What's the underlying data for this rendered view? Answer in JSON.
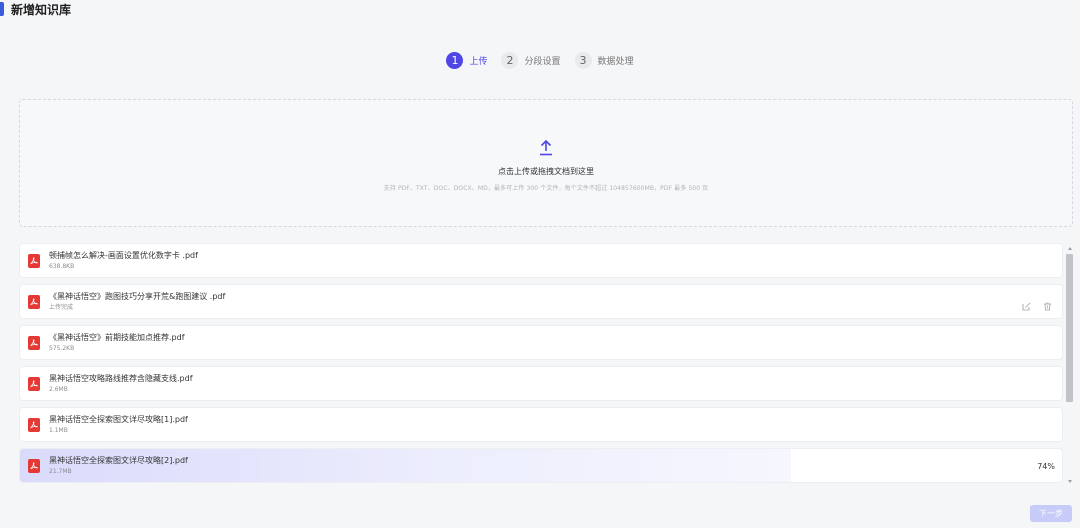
{
  "header": {
    "title": "新增知识库"
  },
  "steps": [
    {
      "num": "1",
      "label": "上传",
      "active": true
    },
    {
      "num": "2",
      "label": "分段设置",
      "active": false
    },
    {
      "num": "3",
      "label": "数据处理",
      "active": false
    }
  ],
  "dropzone": {
    "icon": "upload-icon",
    "main_text": "点击上传或拖拽文档到这里",
    "hint_text": "支持 PDF、TXT、DOC、DOCX、MD，最多可上传 300 个文件，每个文件不超过 104857600MB，PDF 最多 500 页"
  },
  "files": [
    {
      "name": "顿捕帧怎么解决-画面设置优化数字卡 .pdf",
      "sub": "638.8KB",
      "icon": "pdf-icon"
    },
    {
      "name": "《黑神话悟空》跑图技巧分享开荒&跑图建议 .pdf",
      "sub": "上传完成",
      "icon": "pdf-icon",
      "actions": [
        "edit-icon",
        "delete-icon"
      ]
    },
    {
      "name": "《黑神话悟空》前期技能加点推荐.pdf",
      "sub": "575.2KB",
      "icon": "pdf-icon"
    },
    {
      "name": "黑神话悟空攻略路线推荐含隐藏支线.pdf",
      "sub": "2.6MB",
      "icon": "pdf-icon"
    },
    {
      "name": "黑神话悟空全探索图文详尽攻略[1].pdf",
      "sub": "1.1MB",
      "icon": "pdf-icon"
    },
    {
      "name": "黑神话悟空全探索图文详尽攻略[2].pdf",
      "sub": "21.7MB",
      "icon": "pdf-icon",
      "progress": 0.74,
      "percent": "74%"
    }
  ],
  "footer": {
    "next_label": "下一步"
  },
  "colors": {
    "accent": "#4f46e5",
    "pdf": "#e53935",
    "progress": "#dadbfb",
    "next_disabled": "#c7cbf8"
  }
}
